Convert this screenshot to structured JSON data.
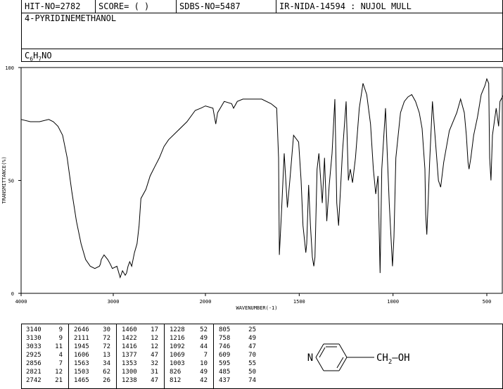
{
  "header": {
    "hit_no": "HIT-NO=2782",
    "score": "SCORE=  (   )",
    "sdbs_no": "SDBS-NO=5487",
    "ir_info": "IR-NIDA-14594 : NUJOL MULL"
  },
  "compound": {
    "name": "4-PYRIDINEMETHANOL",
    "formula_c": "C",
    "formula_c_sub": "6",
    "formula_h": "H",
    "formula_h_sub": "7",
    "formula_rest": "NO"
  },
  "chart_data": {
    "type": "line",
    "title": "",
    "xlabel": "WAVENUMBER(-1)",
    "ylabel": "TRANSMITTANCE(%)",
    "xlim": [
      4000,
      400
    ],
    "ylim": [
      0,
      100
    ],
    "xticks": [
      4000,
      3000,
      2000,
      1500,
      1000,
      500
    ],
    "yticks": [
      0,
      50,
      100
    ],
    "x_reversed": true,
    "grid": false,
    "series": [
      {
        "x": [
          4000,
          3900,
          3800,
          3700,
          3650,
          3600,
          3550,
          3500,
          3450,
          3400,
          3350,
          3300,
          3250,
          3200,
          3150,
          3140,
          3130,
          3100,
          3060,
          3033,
          3010,
          2960,
          2925,
          2900,
          2870,
          2856,
          2840,
          2821,
          2800,
          2770,
          2742,
          2720,
          2700,
          2646,
          2600,
          2550,
          2500,
          2450,
          2400,
          2300,
          2200,
          2111,
          2050,
          2000,
          1960,
          1945,
          1935,
          1900,
          1860,
          1850,
          1830,
          1800,
          1750,
          1700,
          1650,
          1620,
          1610,
          1606,
          1595,
          1580,
          1563,
          1550,
          1530,
          1503,
          1490,
          1480,
          1465,
          1460,
          1450,
          1440,
          1430,
          1422,
          1416,
          1405,
          1395,
          1377,
          1365,
          1353,
          1340,
          1325,
          1310,
          1300,
          1290,
          1270,
          1250,
          1238,
          1228,
          1216,
          1200,
          1180,
          1160,
          1140,
          1120,
          1105,
          1092,
          1080,
          1069,
          1060,
          1040,
          1030,
          1020,
          1003,
          995,
          985,
          960,
          940,
          920,
          900,
          880,
          860,
          845,
          830,
          826,
          820,
          812,
          805,
          790,
          758,
          746,
          730,
          700,
          660,
          640,
          620,
          609,
          600,
          595,
          585,
          570,
          550,
          530,
          510,
          500,
          490,
          485,
          478,
          470,
          450,
          437,
          430,
          410,
          400
        ],
        "y": [
          77,
          76,
          76,
          77,
          76,
          74,
          70,
          60,
          45,
          32,
          22,
          15,
          12,
          11,
          12,
          13,
          15,
          17,
          15,
          13,
          11,
          12,
          7,
          10,
          8,
          9,
          12,
          14,
          12,
          18,
          22,
          30,
          42,
          46,
          52,
          56,
          60,
          65,
          68,
          72,
          76,
          81,
          82,
          83,
          82,
          75,
          80,
          85,
          84,
          82,
          85,
          86,
          86,
          86,
          84,
          82,
          60,
          17,
          35,
          62,
          38,
          50,
          70,
          67,
          50,
          30,
          18,
          22,
          48,
          30,
          16,
          12,
          16,
          55,
          62,
          40,
          60,
          32,
          48,
          62,
          86,
          40,
          30,
          62,
          85,
          50,
          55,
          49,
          60,
          82,
          93,
          88,
          75,
          55,
          44,
          52,
          9,
          55,
          82,
          60,
          40,
          12,
          25,
          60,
          80,
          85,
          87,
          88,
          85,
          80,
          73,
          55,
          35,
          26,
          42,
          58,
          85,
          50,
          47,
          58,
          72,
          80,
          86,
          80,
          70,
          58,
          55,
          60,
          70,
          78,
          88,
          92,
          95,
          93,
          60,
          50,
          70,
          82,
          74,
          85,
          88,
          89
        ]
      }
    ]
  },
  "peak_table": {
    "columns": [
      [
        [
          "3140",
          "9"
        ],
        [
          "3130",
          "9"
        ],
        [
          "3033",
          "11"
        ],
        [
          "2925",
          "4"
        ],
        [
          "2856",
          "7"
        ],
        [
          "2821",
          "12"
        ],
        [
          "2742",
          "21"
        ]
      ],
      [
        [
          "2646",
          "30"
        ],
        [
          "2111",
          "72"
        ],
        [
          "1945",
          "72"
        ],
        [
          "1606",
          "13"
        ],
        [
          "1563",
          "34"
        ],
        [
          "1503",
          "62"
        ],
        [
          "1465",
          "26"
        ]
      ],
      [
        [
          "1460",
          "17"
        ],
        [
          "1422",
          "12"
        ],
        [
          "1416",
          "12"
        ],
        [
          "1377",
          "47"
        ],
        [
          "1353",
          "32"
        ],
        [
          "1300",
          "31"
        ],
        [
          "1238",
          "47"
        ]
      ],
      [
        [
          "1228",
          "52"
        ],
        [
          "1216",
          "49"
        ],
        [
          "1092",
          "44"
        ],
        [
          "1069",
          "7"
        ],
        [
          "1003",
          "10"
        ],
        [
          "826",
          "49"
        ],
        [
          "812",
          "42"
        ]
      ],
      [
        [
          "805",
          "25"
        ],
        [
          "758",
          "49"
        ],
        [
          "746",
          "47"
        ],
        [
          "609",
          "70"
        ],
        [
          "595",
          "55"
        ],
        [
          "485",
          "50"
        ],
        [
          "437",
          "74"
        ]
      ]
    ]
  },
  "structure": {
    "ring_atom": "N",
    "substituent": "CH",
    "substituent_sub": "2",
    "substituent_rest": "—OH"
  }
}
